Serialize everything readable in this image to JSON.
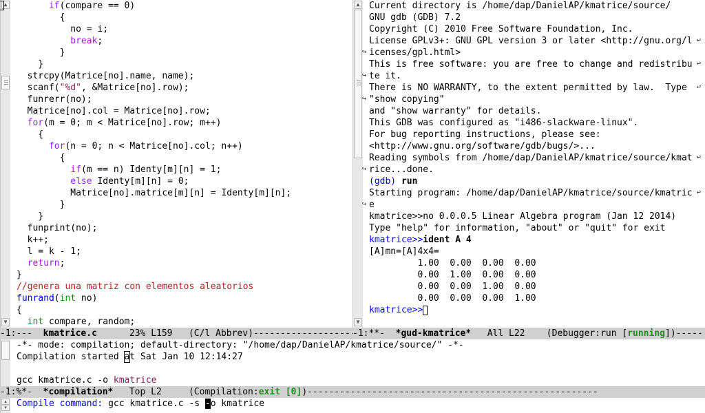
{
  "editor": {
    "lines": [
      "      if(compare == 0)",
      "        {",
      "          no = i;",
      "          break;",
      "        }",
      "    }",
      "  strcpy(Matrice[no].name, name);",
      "  scanf(\"%d\", &Matrice[no].row);",
      "  funrerr(no);",
      "  Matrice[no].col = Matrice[no].row;",
      "  for(m = 0; m < Matrice[no].row; m++)",
      "    {",
      "      for(n = 0; n < Matrice[no].col; n++)",
      "        {",
      "          if(m == n) Identy[m][n] = 1;",
      "          else Identy[m][n] = 0;",
      "          Matrice[no].matrice[m][n] = Identy[m][n];",
      "        }",
      "    }",
      "  funprint(no);",
      "  k++;",
      "  l = k - 1;",
      "  return;",
      "}",
      "//genera una matriz con elementos aleatorios",
      "funrand(int no)",
      "{",
      "  int compare, random;"
    ]
  },
  "editor_modeline": {
    "text": "-1:---  kmatrice.c      23% L159   (C/l Abbrev)-----------------------------------",
    "buffer": "kmatrice.c",
    "position": "23%",
    "line": "L159",
    "mode": "(C/l Abbrev)"
  },
  "gdb": {
    "lines": [
      "Current directory is /home/dap/DanielAP/kmatrice/source/",
      "GNU gdb (GDB) 7.2",
      "Copyright (C) 2010 Free Software Foundation, Inc.",
      "License GPLv3+: GNU GPL version 3 or later <http://gnu.org/l",
      "icenses/gpl.html>",
      "This is free software: you are free to change and redistribu",
      "te it.",
      "There is NO WARRANTY, to the extent permitted by law.  Type ",
      "\"show copying\"",
      "and \"show warranty\" for details.",
      "This GDB was configured as \"i486-slackware-linux\".",
      "For bug reporting instructions, please see:",
      "<http://www.gnu.org/software/gdb/bugs/>...",
      "Reading symbols from /home/dap/DanielAP/kmatrice/source/kmat",
      "rice...done.",
      "(gdb) run",
      "Starting program: /home/dap/DanielAP/kmatrice/source/kmatric",
      "e",
      "kmatrice>>no 0.0.0.5 Linear Algebra program (Jan 12 2014)",
      "Type \"help\" for information, \"about\" or \"quit\" for exit",
      "kmatrice>>ident A 4",
      "[A]mn=[A]4x4=",
      "         1.00  0.00  0.00  0.00",
      "         0.00  1.00  0.00  0.00",
      "         0.00  0.00  1.00  0.00",
      "         0.00  0.00  0.00  1.00",
      "kmatrice>>"
    ]
  },
  "gdb_modeline": {
    "prefix": "-1:**-  ",
    "buffer": "*gud-kmatrice*",
    "position": "All",
    "line": "L22",
    "mode_before": "(Debugger:run [",
    "status": "running",
    "mode_after": "])-----"
  },
  "compilation": {
    "header": "-*- mode: compilation; default-directory: \"/home/dap/DanielAP/kmatrice/source/\" -*-",
    "started_prefix": "Compilation started ",
    "started_cursor_char": "a",
    "started_suffix": "t Sat Jan 10 12:14:27",
    "command_line_prefix": "gcc kmatrice.c -o ",
    "command_line_target": "kmatrice"
  },
  "compilation_modeline": {
    "prefix": "-1:%*-  ",
    "buffer": "*compilation*",
    "position": "Top",
    "line": "L2",
    "mode_before": "(Compilation:",
    "status": "exit [0]",
    "mode_after": ")------------------------------------------------------"
  },
  "minibuffer": {
    "prompt": "Compile command: ",
    "value_before": "gcc kmatrice.c -s ",
    "cursor_char": "-",
    "value_after": "o kmatrice"
  },
  "colors": {
    "keyword": "#a020f0",
    "type": "#228b22",
    "function": "#0000ff",
    "string": "#8b2252",
    "comment": "#b22222",
    "modeline_bg": "#d0d0d0"
  }
}
